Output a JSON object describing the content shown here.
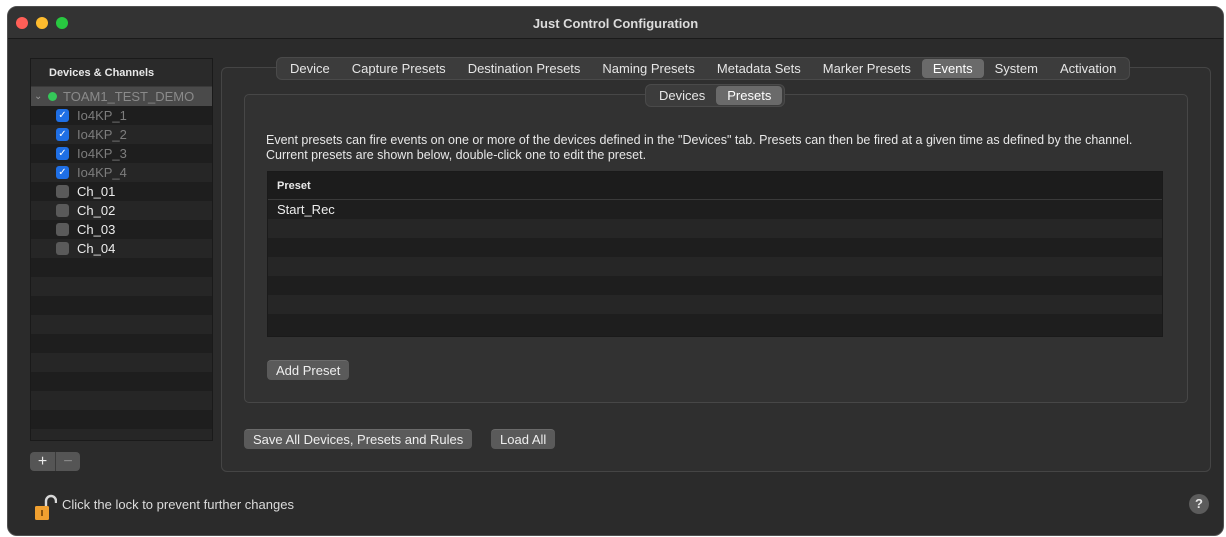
{
  "window": {
    "title": "Just Control Configuration"
  },
  "sidebar": {
    "header": "Devices & Channels",
    "device": {
      "name": "TOAM1_TEST_DEMO",
      "status_color": "#35c759"
    },
    "channels": [
      {
        "label": "Io4KP_1",
        "checked": true,
        "dim": true
      },
      {
        "label": "Io4KP_2",
        "checked": true,
        "dim": true
      },
      {
        "label": "Io4KP_3",
        "checked": true,
        "dim": true
      },
      {
        "label": "Io4KP_4",
        "checked": true,
        "dim": true
      },
      {
        "label": "Ch_01",
        "checked": false,
        "dim": false
      },
      {
        "label": "Ch_02",
        "checked": false,
        "dim": false
      },
      {
        "label": "Ch_03",
        "checked": false,
        "dim": false
      },
      {
        "label": "Ch_04",
        "checked": false,
        "dim": false
      }
    ],
    "add_label": "+",
    "remove_label": "−"
  },
  "tabs": [
    {
      "label": "Device",
      "active": false
    },
    {
      "label": "Capture Presets",
      "active": false
    },
    {
      "label": "Destination Presets",
      "active": false
    },
    {
      "label": "Naming Presets",
      "active": false
    },
    {
      "label": "Metadata Sets",
      "active": false
    },
    {
      "label": "Marker Presets",
      "active": false
    },
    {
      "label": "Events",
      "active": true
    },
    {
      "label": "System",
      "active": false
    },
    {
      "label": "Activation",
      "active": false
    }
  ],
  "subtabs": [
    {
      "label": "Devices",
      "active": false
    },
    {
      "label": "Presets",
      "active": true
    }
  ],
  "events": {
    "description": "Event presets can fire events on one or more of the devices defined in the \"Devices\" tab. Presets can then be fired at a given time as defined by the channel. Current presets are shown below, double-click one to edit the preset.",
    "table": {
      "column_header": "Preset",
      "rows": [
        "Start_Rec"
      ]
    },
    "add_preset_label": "Add Preset"
  },
  "footer": {
    "save_all_label": "Save All Devices, Presets and Rules",
    "load_all_label": "Load All",
    "lock_text": "Click the lock to prevent further changes",
    "help_label": "?"
  },
  "colors": {
    "checkbox_checked": "#1f6fe5",
    "lock_body": "#f0a030"
  }
}
